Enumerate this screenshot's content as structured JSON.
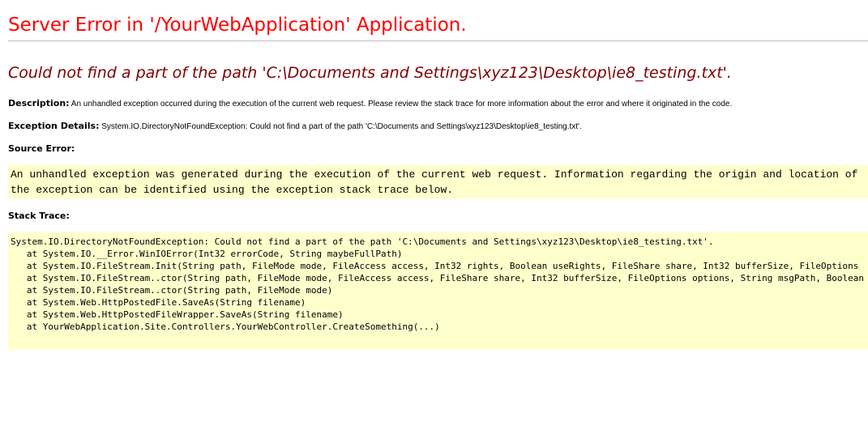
{
  "page": {
    "title": "Server Error in '/YourWebApplication' Application.",
    "subtitle": "Could not find a part of the path 'C:\\Documents and Settings\\xyz123\\Desktop\\ie8_testing.txt'."
  },
  "description": {
    "label": "Description:",
    "text": "An unhandled exception occurred during the execution of the current web request. Please review the stack trace for more information about the error and where it originated in the code."
  },
  "exception_details": {
    "label": "Exception Details:",
    "text": "System.IO.DirectoryNotFoundException: Could not find a part of the path 'C:\\Documents and Settings\\xyz123\\Desktop\\ie8_testing.txt'."
  },
  "source_error": {
    "label": "Source Error:",
    "lines": [
      "An unhandled exception was generated during the execution of the current web request. Information regarding the origin and location of",
      "the exception can be identified using the exception stack trace below."
    ]
  },
  "stack_trace": {
    "label": "Stack Trace:",
    "lines": [
      "System.IO.DirectoryNotFoundException: Could not find a part of the path 'C:\\Documents and Settings\\xyz123\\Desktop\\ie8_testing.txt'.",
      "   at System.IO.__Error.WinIOError(Int32 errorCode, String maybeFullPath)",
      "   at System.IO.FileStream.Init(String path, FileMode mode, FileAccess access, Int32 rights, Boolean useRights, FileShare share, Int32 bufferSize, FileOptions",
      "   at System.IO.FileStream..ctor(String path, FileMode mode, FileAccess access, FileShare share, Int32 bufferSize, FileOptions options, String msgPath, Boolean",
      "   at System.IO.FileStream..ctor(String path, FileMode mode)",
      "   at System.Web.HttpPostedFile.SaveAs(String filename)",
      "   at System.Web.HttpPostedFileWrapper.SaveAs(String filename)",
      "   at YourWebApplication.Site.Controllers.YourWebController.CreateSomething(...)"
    ]
  },
  "colors": {
    "title": "#ff0000",
    "subtitle": "#800000",
    "code_background": "#ffffcc",
    "rule": "#c0c0c0"
  }
}
